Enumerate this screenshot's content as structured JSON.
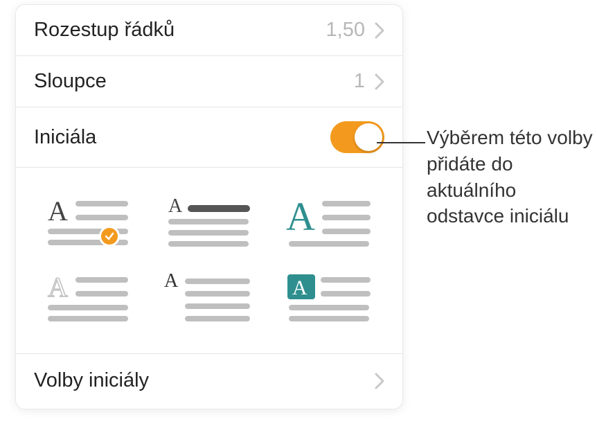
{
  "panel": {
    "lineSpacing": {
      "label": "Rozestup řádků",
      "value": "1,50"
    },
    "columns": {
      "label": "Sloupce",
      "value": "1"
    },
    "dropCap": {
      "label": "Iniciála",
      "enabled": true
    },
    "options": {
      "label": "Volby iniciály"
    }
  },
  "styles": [
    {
      "name": "dropcap-style-1",
      "selected": true
    },
    {
      "name": "dropcap-style-2",
      "selected": false
    },
    {
      "name": "dropcap-style-3",
      "selected": false
    },
    {
      "name": "dropcap-style-4",
      "selected": false
    },
    {
      "name": "dropcap-style-5",
      "selected": false
    },
    {
      "name": "dropcap-style-6",
      "selected": false
    }
  ],
  "callout": {
    "text": "Výběrem této volby přidáte do aktuálního odstavce iniciálu"
  },
  "colors": {
    "accent": "#f39a1e",
    "teal": "#2f8f8f",
    "grayLine": "#bfbfbf",
    "boldLine": "#555"
  }
}
